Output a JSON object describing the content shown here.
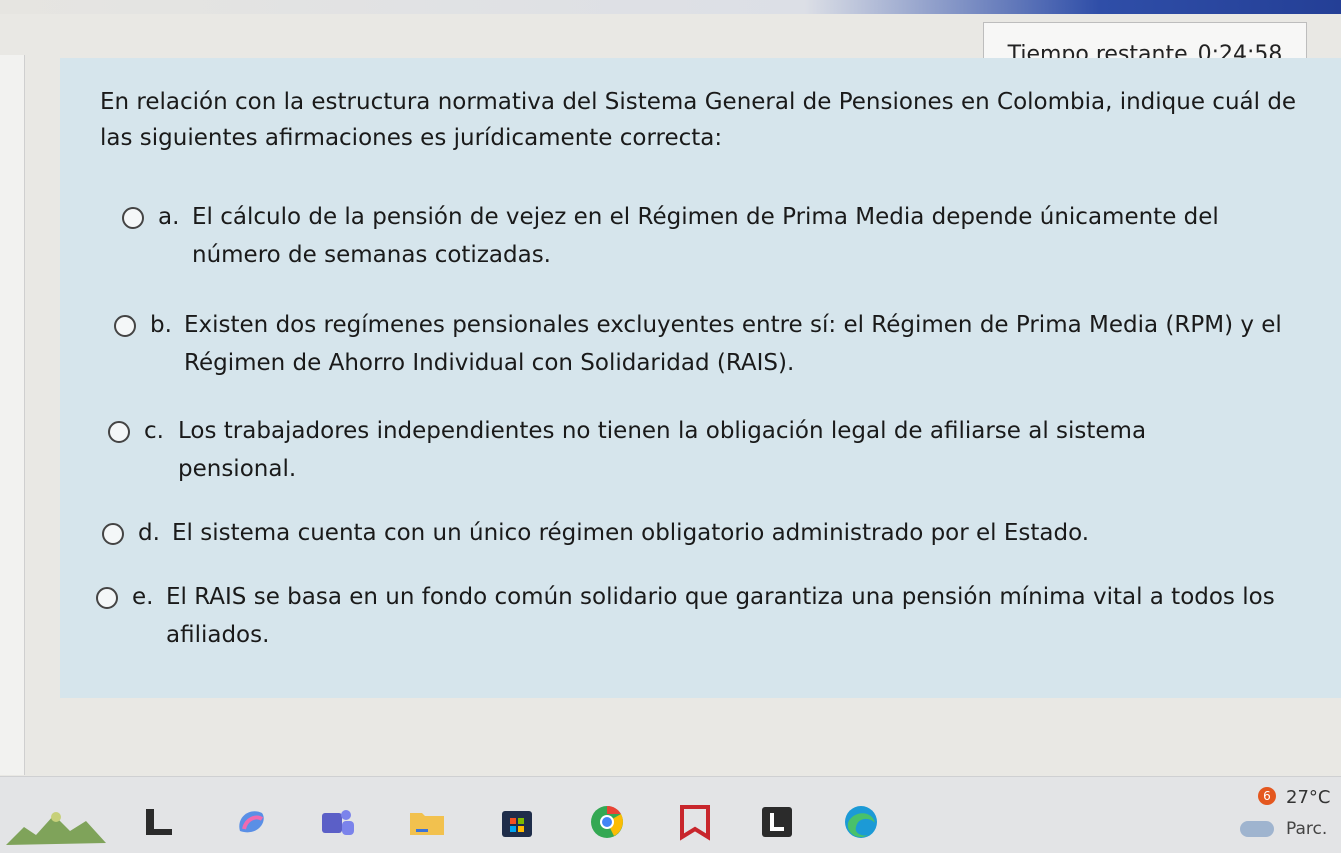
{
  "timer": {
    "label": "Tiempo restante",
    "value": "0:24:58"
  },
  "question": {
    "text": "En relación con la estructura normativa del Sistema General de Pensiones en Colombia, indique cuál de las siguientes afirmaciones es jurídicamente correcta:",
    "options": [
      {
        "letter": "a.",
        "text": "El cálculo de la pensión de vejez en el Régimen de Prima Media depende únicamente del número de semanas cotizadas."
      },
      {
        "letter": "b.",
        "text": "Existen dos regímenes pensionales excluyentes entre sí: el Régimen de Prima Media (RPM) y el Régimen de Ahorro Individual con Solidaridad (RAIS)."
      },
      {
        "letter": "c.",
        "text": "Los trabajadores independientes no tienen la obligación legal de afiliarse al sistema pensional."
      },
      {
        "letter": "d.",
        "text": "El sistema cuenta con un único régimen obligatorio administrado por el Estado."
      },
      {
        "letter": "e.",
        "text": "El RAIS se basa en un fondo común solidario que garantiza una pensión mínima vital a todos los afiliados."
      }
    ]
  },
  "taskbar": {
    "weather_badge": "6",
    "temperature": "27°C",
    "condition": "Parc.",
    "icons": [
      "widgets-landscape-icon",
      "file-explorer-icon",
      "copilot-icon",
      "teams-icon",
      "folder-icon",
      "microsoft-store-icon",
      "chrome-icon",
      "app-bookmark-icon",
      "app-l-icon",
      "edge-icon"
    ]
  },
  "colors": {
    "panel": "#d6e5ec",
    "taskbar": "#e3e4e6",
    "accent_blue": "#243f96"
  }
}
